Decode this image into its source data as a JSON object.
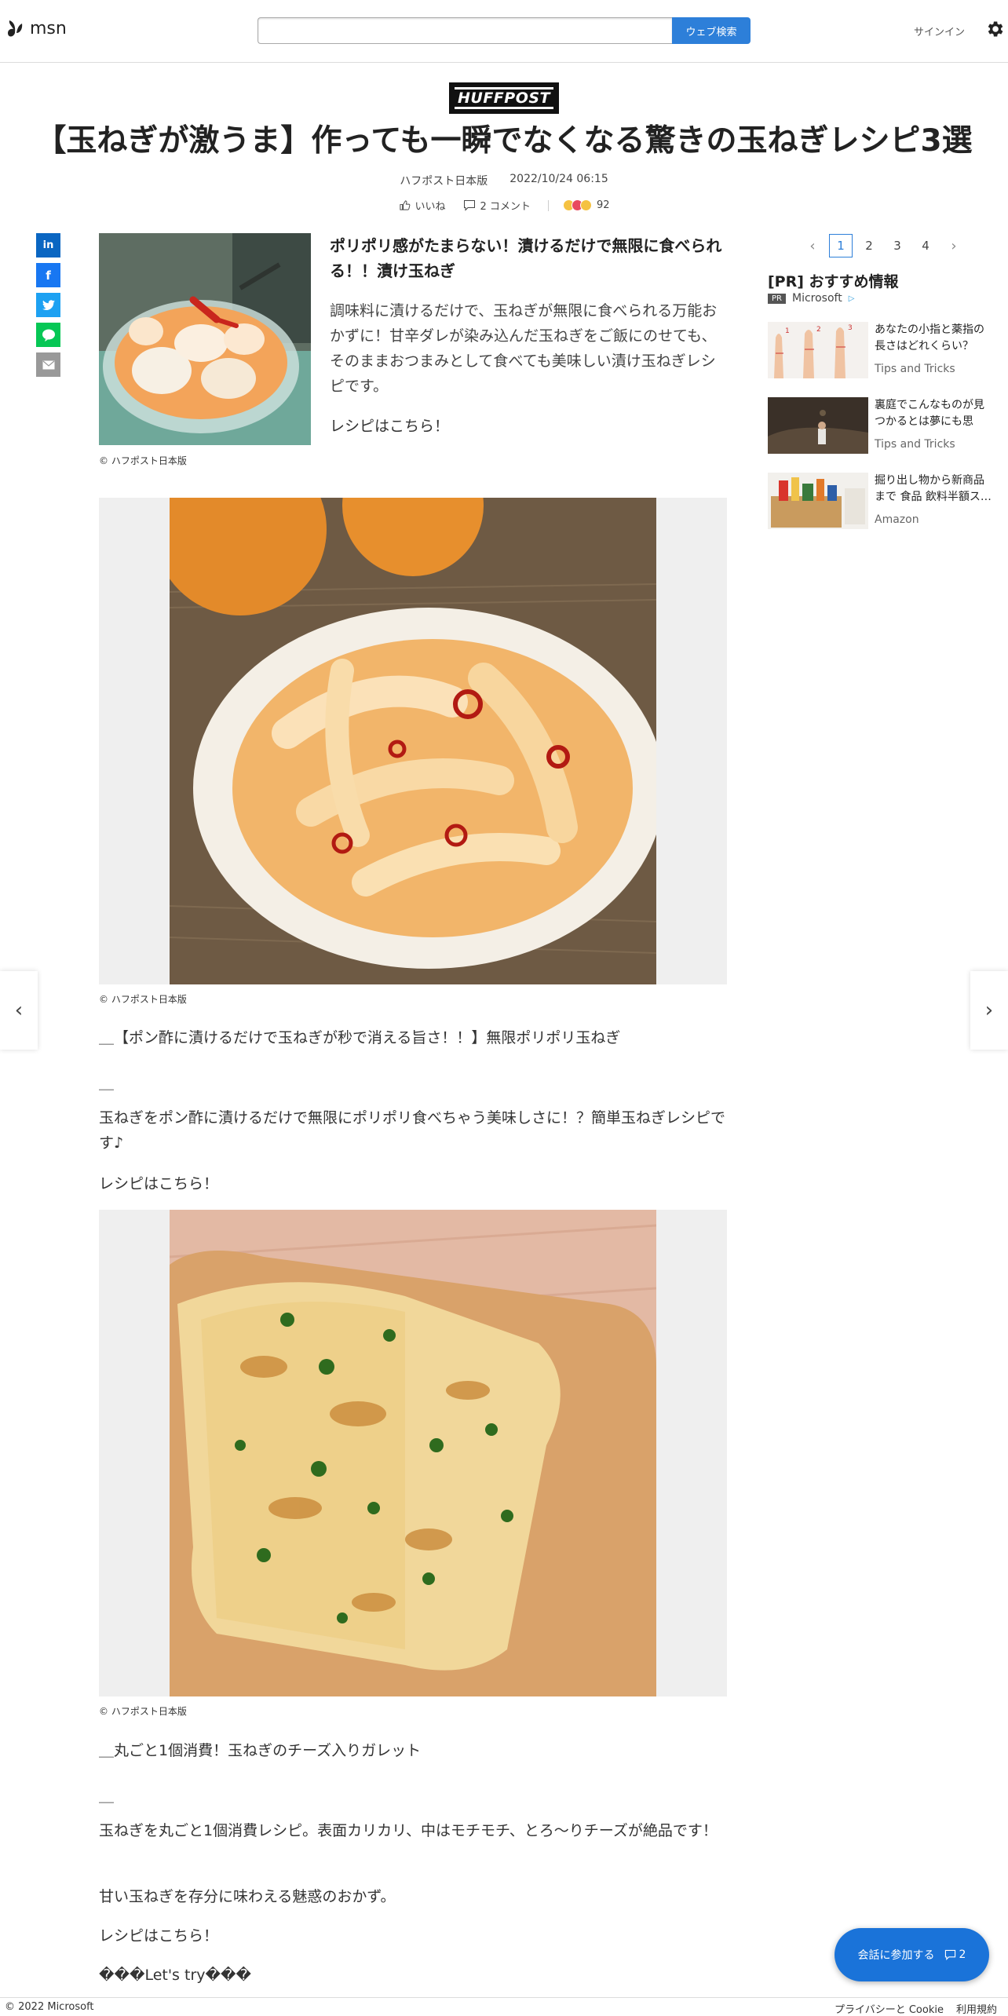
{
  "header": {
    "logo_text": "msn",
    "search_placeholder": "",
    "search_button": "ウェブ検索",
    "signin": "サインイン"
  },
  "article": {
    "brand": "HUFFPOST",
    "title": "【玉ねぎが激うま】作っても一瞬でなくなる驚きの玉ねぎレシピ3選",
    "source": "ハフポスト日本版",
    "datetime": "2022/10/24 06:15",
    "like_label": "いいね",
    "comment_label": "2 コメント",
    "reaction_count": "92",
    "intro": {
      "title": "ポリポリ感がたまらない！漬けるだけで無限に食べられる！！漬け玉ねぎ",
      "body": "調味料に漬けるだけで、玉ねぎが無限に食べられる万能おかずに！甘辛ダレが染み込んだ玉ねぎをご飯にのせても、そのままおつまみとして食べても美味しい漬け玉ねぎレシピです。",
      "link": "レシピはこちら！",
      "caption": "© ハフポスト日本版"
    },
    "section2": {
      "caption": "© ハフポスト日本版",
      "heading": "＿【ポン酢に漬けるだけで玉ねぎが秒で消える旨さ！！】無限ポリポリ玉ねぎ",
      "divider": "＿",
      "body": "玉ねぎをポン酢に漬けるだけで無限にポリポリ食べちゃう美味しさに！？簡単玉ねぎレシピです♪",
      "link": "レシピはこちら！"
    },
    "section3": {
      "caption": "© ハフポスト日本版",
      "heading": "＿丸ごと1個消費！玉ねぎのチーズ入りガレット",
      "divider": "＿",
      "body": "玉ねぎを丸ごと1個消費レシピ。表面カリカリ、中はモチモチ、とろ〜りチーズが絶品です！",
      "body2": "甘い玉ねぎを存分に味わえる魅惑のおかず。",
      "link": "レシピはこちら！",
      "tail": "���Let's try���"
    }
  },
  "share": [
    {
      "label": "in",
      "color": "#0a66c2"
    },
    {
      "label": "f",
      "color": "#1877f2"
    },
    {
      "label": "t",
      "color": "#1da1f2"
    },
    {
      "label": "LINE",
      "color": "#06c755"
    },
    {
      "label": "✉",
      "color": "#999999"
    }
  ],
  "sidebar": {
    "pages": [
      "1",
      "2",
      "3",
      "4"
    ],
    "section_title": "[PR] おすすめ情報",
    "pr_tag": "PR",
    "sponsor": "Microsoft",
    "items": [
      {
        "text": "あなたの小指と薬指の長さはどれくらい？こ…",
        "source": "Tips and Tricks"
      },
      {
        "text": "裏庭でこんなものが見つかるとは夢にも思い…",
        "source": "Tips and Tricks"
      },
      {
        "text": "掘り出し物から新商品まで 食品 飲料半額ス…",
        "source": "Amazon"
      }
    ]
  },
  "conversation": {
    "label": "会話に参加する",
    "count": "2"
  },
  "footer": {
    "copyright": "© 2022 Microsoft",
    "privacy": "プライバシーと Cookie",
    "terms": "利用規約"
  },
  "colors": {
    "accent": "#2d7fd9",
    "convo_button": "#1a73d9"
  }
}
